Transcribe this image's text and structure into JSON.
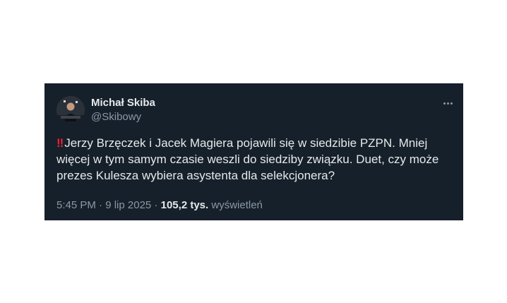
{
  "tweet": {
    "author": {
      "display_name": "Michał Skiba",
      "handle": "@Skibowy"
    },
    "alert_glyph": "‼",
    "text": "Jerzy Brzęczek i Jacek Magiera pojawili się w siedzibie PZPN. Mniej więcej w tym samym czasie weszli do siedziby związku. Duet, czy może prezes Kulesza wybiera asystenta dla selekcjonera?",
    "time": "5:45 PM",
    "date": "9 lip 2025",
    "separator": "·",
    "views_count": "105,2 tys.",
    "views_label": "wyświetleń"
  },
  "colors": {
    "card_background": "#15202b",
    "primary_text": "#e7e9ea",
    "secondary_text": "#8b98a5",
    "alert_red": "#f4212e"
  }
}
